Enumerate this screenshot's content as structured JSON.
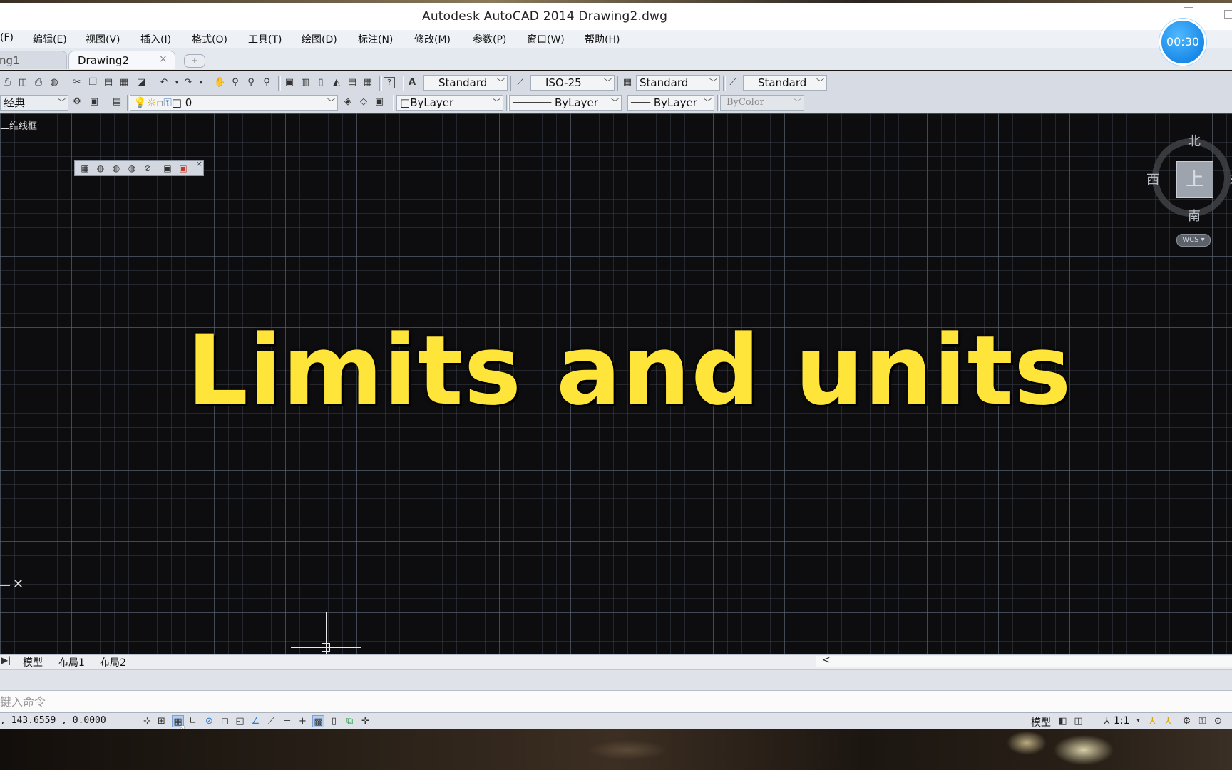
{
  "window": {
    "title": "Autodesk AutoCAD 2014      Drawing2.dwg"
  },
  "timer": "00:30",
  "menu": [
    "(F)",
    "编辑(E)",
    "视图(V)",
    "插入(I)",
    "格式(O)",
    "工具(T)",
    "绘图(D)",
    "标注(N)",
    "修改(M)",
    "参数(P)",
    "窗口(W)",
    "帮助(H)"
  ],
  "tabs": {
    "drawing1": "ng1",
    "drawing2": "Drawing2",
    "close": "×",
    "new": "+"
  },
  "toolbar": {
    "text_style": "Standard",
    "dim_style": "ISO-25",
    "table_style": "Standard",
    "mleader_style": "Standard",
    "workspace": "经典",
    "layer": "0",
    "color": "ByLayer",
    "linetype": "ByLayer",
    "lineweight": "ByLayer",
    "plotstyle": "ByColor"
  },
  "viewport": {
    "view_label": "二维线框",
    "headline": "Limits and units",
    "headline_color": "#ffe43a"
  },
  "viewcube": {
    "north": "北",
    "west": "西",
    "south": "南",
    "east": "东",
    "top_face": "上",
    "wcs": "WCS"
  },
  "layouts": {
    "model": "模型",
    "layout1": "布局1",
    "layout2": "布局2",
    "scroll_left": "<"
  },
  "command": {
    "placeholder": "键入命令"
  },
  "status": {
    "coords": ", 143.6559 , 0.0000",
    "model_label": "模型",
    "scale": "1:1"
  }
}
